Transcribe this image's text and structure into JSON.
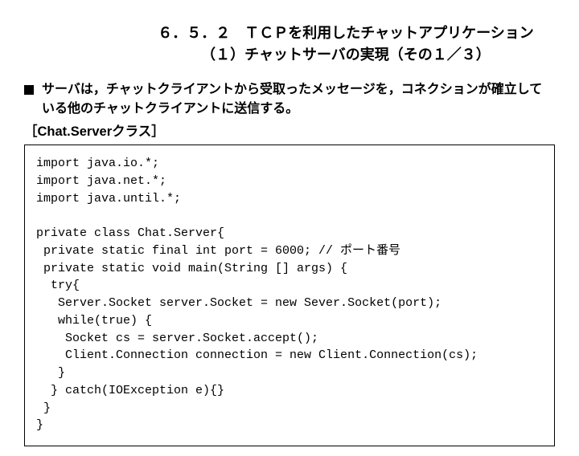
{
  "heading": {
    "line1": "６．５．２　ＴＣＰを利用したチャットアプリケーション",
    "line2": "（１）チャットサーバの実現（その１／３）"
  },
  "bullet": {
    "text": "サーバは，チャットクライアントから受取ったメッセージを，コネクションが確立している他のチャットクライアントに送信する。"
  },
  "class_label": "［Chat.Serverクラス］",
  "code": "import java.io.*;\nimport java.net.*;\nimport java.until.*;\n\nprivate class Chat.Server{\n private static final int port = 6000; // ポート番号\n private static void main(String [] args) {\n  try{\n   Server.Socket server.Socket = new Sever.Socket(port);\n   while(true) {\n    Socket cs = server.Socket.accept();\n    Client.Connection connection = new Client.Connection(cs);\n   }\n  } catch(IOException e){}\n }\n}"
}
